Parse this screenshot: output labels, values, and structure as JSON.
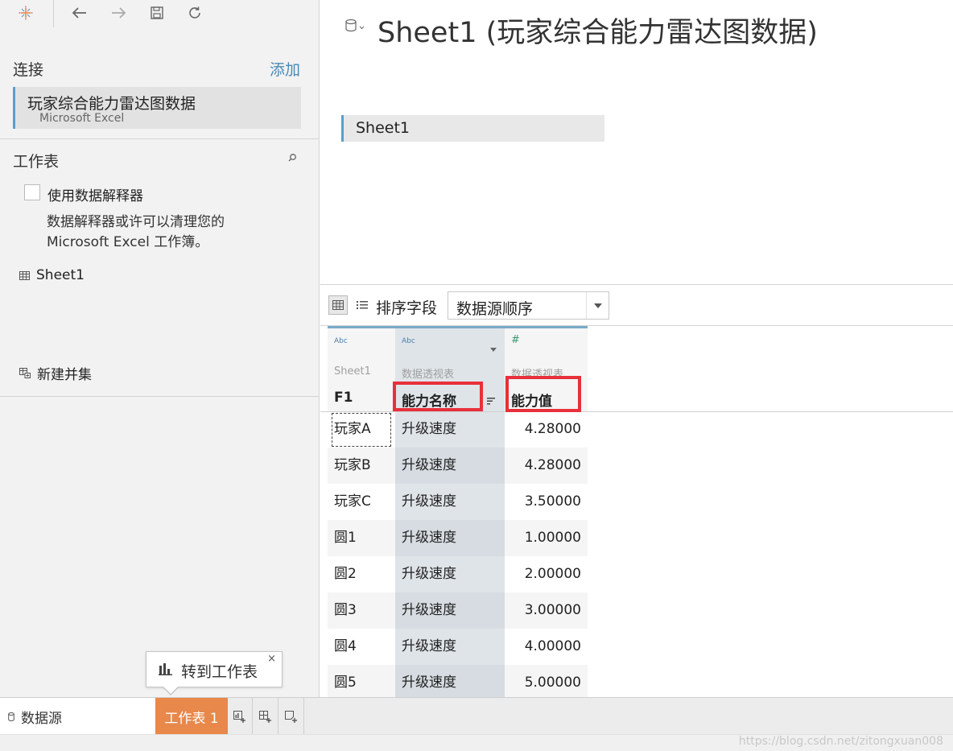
{
  "left_pane": {
    "connections": {
      "title": "连接",
      "add_label": "添加",
      "items": [
        {
          "name": "玩家综合能力雷达图数据",
          "type": "Microsoft Excel"
        }
      ]
    },
    "worksheets": {
      "title": "工作表",
      "use_interpreter_label": "使用数据解释器",
      "interpreter_desc": "数据解释器或许可以清理您的 Microsoft Excel 工作簿。",
      "sheets": [
        {
          "name": "Sheet1"
        }
      ],
      "new_union_label": "新建并集"
    }
  },
  "data_source_title": "Sheet1 (玩家综合能力雷达图数据)",
  "canvas": {
    "tables": [
      {
        "name": "Sheet1"
      }
    ]
  },
  "grid_toolbar": {
    "sort_label": "排序字段",
    "sort_value": "数据源顺序"
  },
  "grid": {
    "columns": [
      {
        "type": "Abc",
        "source": "Sheet1",
        "field": "F1"
      },
      {
        "type": "Abc",
        "source": "数据透视表",
        "field": "能力名称"
      },
      {
        "type": "#",
        "source": "数据透视表",
        "field": "能力值"
      }
    ],
    "rows": [
      [
        "玩家A",
        "升级速度",
        "4.28000"
      ],
      [
        "玩家B",
        "升级速度",
        "4.28000"
      ],
      [
        "玩家C",
        "升级速度",
        "3.50000"
      ],
      [
        "圆1",
        "升级速度",
        "1.00000"
      ],
      [
        "圆2",
        "升级速度",
        "2.00000"
      ],
      [
        "圆3",
        "升级速度",
        "3.00000"
      ],
      [
        "圆4",
        "升级速度",
        "4.00000"
      ],
      [
        "圆5",
        "升级速度",
        "5.00000"
      ]
    ]
  },
  "tooltip": {
    "label": "转到工作表",
    "close": "×"
  },
  "bottom_tabs": {
    "data_source": "数据源",
    "worksheet": "工作表 1"
  },
  "watermark": "https://blog.csdn.net/zitongxuan008",
  "colors": {
    "accent_orange": "#e8884a",
    "accent_blue": "#5b9ec9",
    "highlight_red": "#e8303a",
    "pivot_column_bg": "#dfe4e8"
  }
}
